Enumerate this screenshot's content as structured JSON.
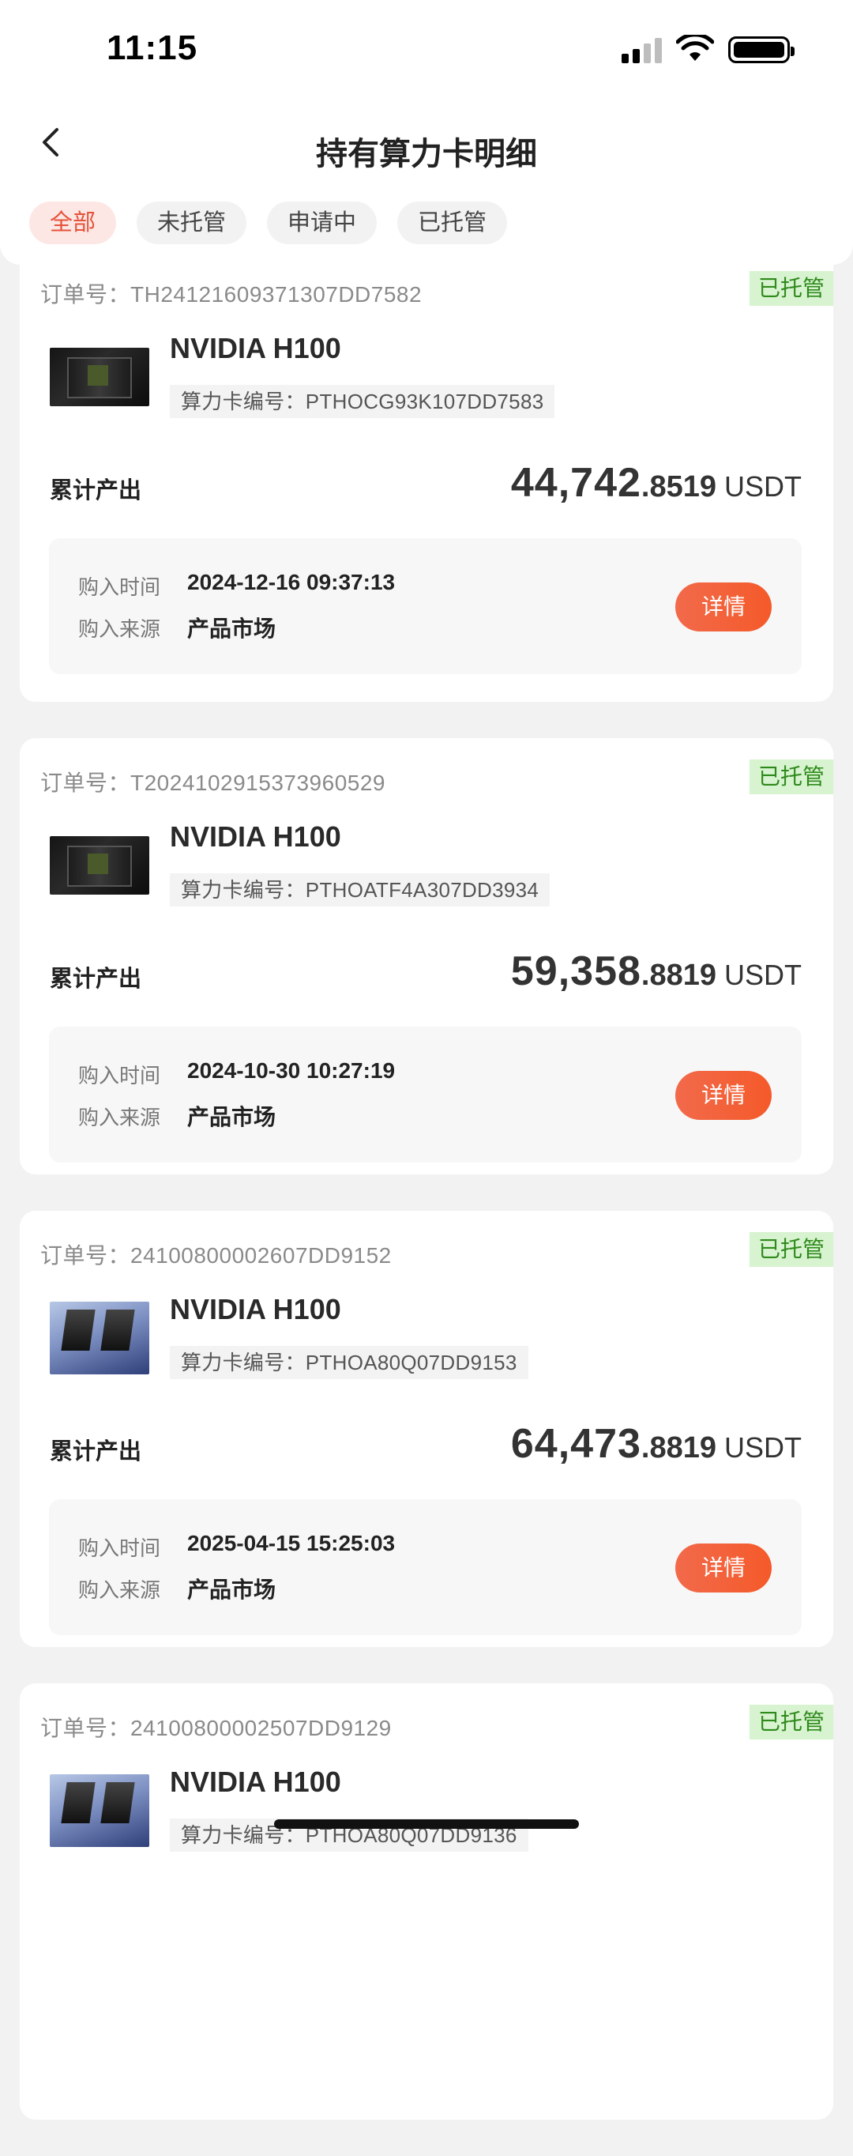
{
  "status_bar": {
    "time": "11:15"
  },
  "header": {
    "title": "持有算力卡明细"
  },
  "tabs": [
    {
      "label": "全部",
      "active": true
    },
    {
      "label": "未托管",
      "active": false
    },
    {
      "label": "申请中",
      "active": false
    },
    {
      "label": "已托管",
      "active": false
    }
  ],
  "labels": {
    "cumulative_output": "累计产出",
    "purchase_time": "购入时间",
    "purchase_source": "购入来源",
    "detail_button": "详情"
  },
  "cards": [
    {
      "order": "订单号：TH24121609371307DD7582",
      "status": "已托管",
      "product": "NVIDIA H100",
      "card_no": "算力卡编号：PTHOCG93K107DD7583",
      "amount_int": "44,742",
      "amount_dec": ".8519",
      "unit": "USDT",
      "purchase_time": "2024-12-16 09:37:13",
      "source": "产品市场",
      "image": "gpu-dark"
    },
    {
      "order": "订单号：T2024102915373960529",
      "status": "已托管",
      "product": "NVIDIA H100",
      "card_no": "算力卡编号：PTHOATF4A307DD3934",
      "amount_int": "59,358",
      "amount_dec": ".8819",
      "unit": "USDT",
      "purchase_time": "2024-10-30 10:27:19",
      "source": "产品市场",
      "image": "gpu-dark"
    },
    {
      "order": "订单号：24100800002607DD9152",
      "status": "已托管",
      "product": "NVIDIA H100",
      "card_no": "算力卡编号：PTHOA80Q07DD9153",
      "amount_int": "64,473",
      "amount_dec": ".8819",
      "unit": "USDT",
      "purchase_time": "2025-04-15 15:25:03",
      "source": "产品市场",
      "image": "gpu-blue"
    },
    {
      "order": "订单号：24100800002507DD9129",
      "status": "已托管",
      "product": "NVIDIA H100",
      "card_no": "算力卡编号：PTHOA80Q07DD9136",
      "image": "gpu-blue"
    }
  ]
}
